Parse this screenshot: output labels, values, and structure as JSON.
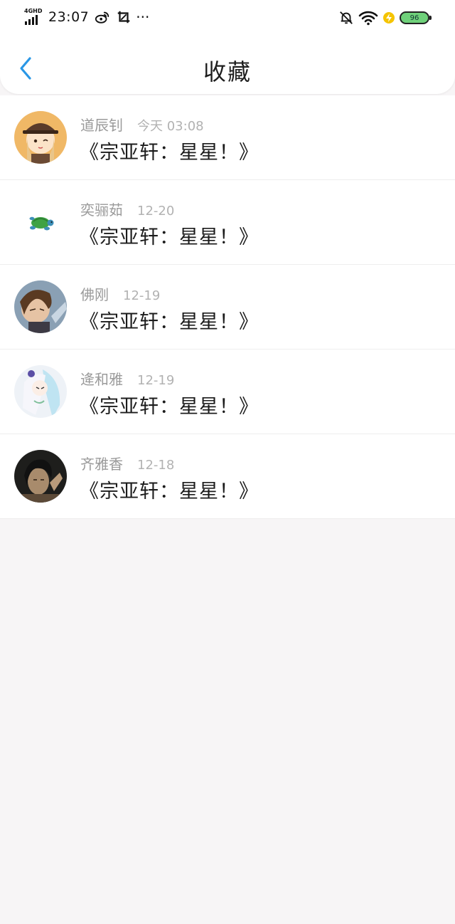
{
  "status_bar": {
    "network": "4G",
    "network_sub": "HD",
    "time": "23:07",
    "battery": "96",
    "icons": [
      "weibo-icon",
      "screenshot-icon",
      "more-dots-icon",
      "bell-muted-icon",
      "wifi-icon",
      "charging-icon",
      "battery-icon"
    ],
    "battery_color": "#6fd17a"
  },
  "nav": {
    "title": "收藏",
    "back_icon": "chevron-left-icon",
    "accent": "#2a97e6"
  },
  "favorites": [
    {
      "name": "道辰钊",
      "time": "今天 03:08",
      "title": "《宗亚轩：星星！》",
      "avatar": "anime-girl-hat-avatar"
    },
    {
      "name": "奕骊茹",
      "time": "12-20",
      "title": "《宗亚轩：星星！》",
      "avatar": "turtle-avatar"
    },
    {
      "name": "佛刚",
      "time": "12-19",
      "title": "《宗亚轩：星星！》",
      "avatar": "anime-boy-avatar"
    },
    {
      "name": "逄和雅",
      "time": "12-19",
      "title": "《宗亚轩：星星！》",
      "avatar": "anime-white-hair-avatar"
    },
    {
      "name": "齐雅香",
      "time": "12-18",
      "title": "《宗亚轩：星星！》",
      "avatar": "photo-person-avatar"
    }
  ]
}
